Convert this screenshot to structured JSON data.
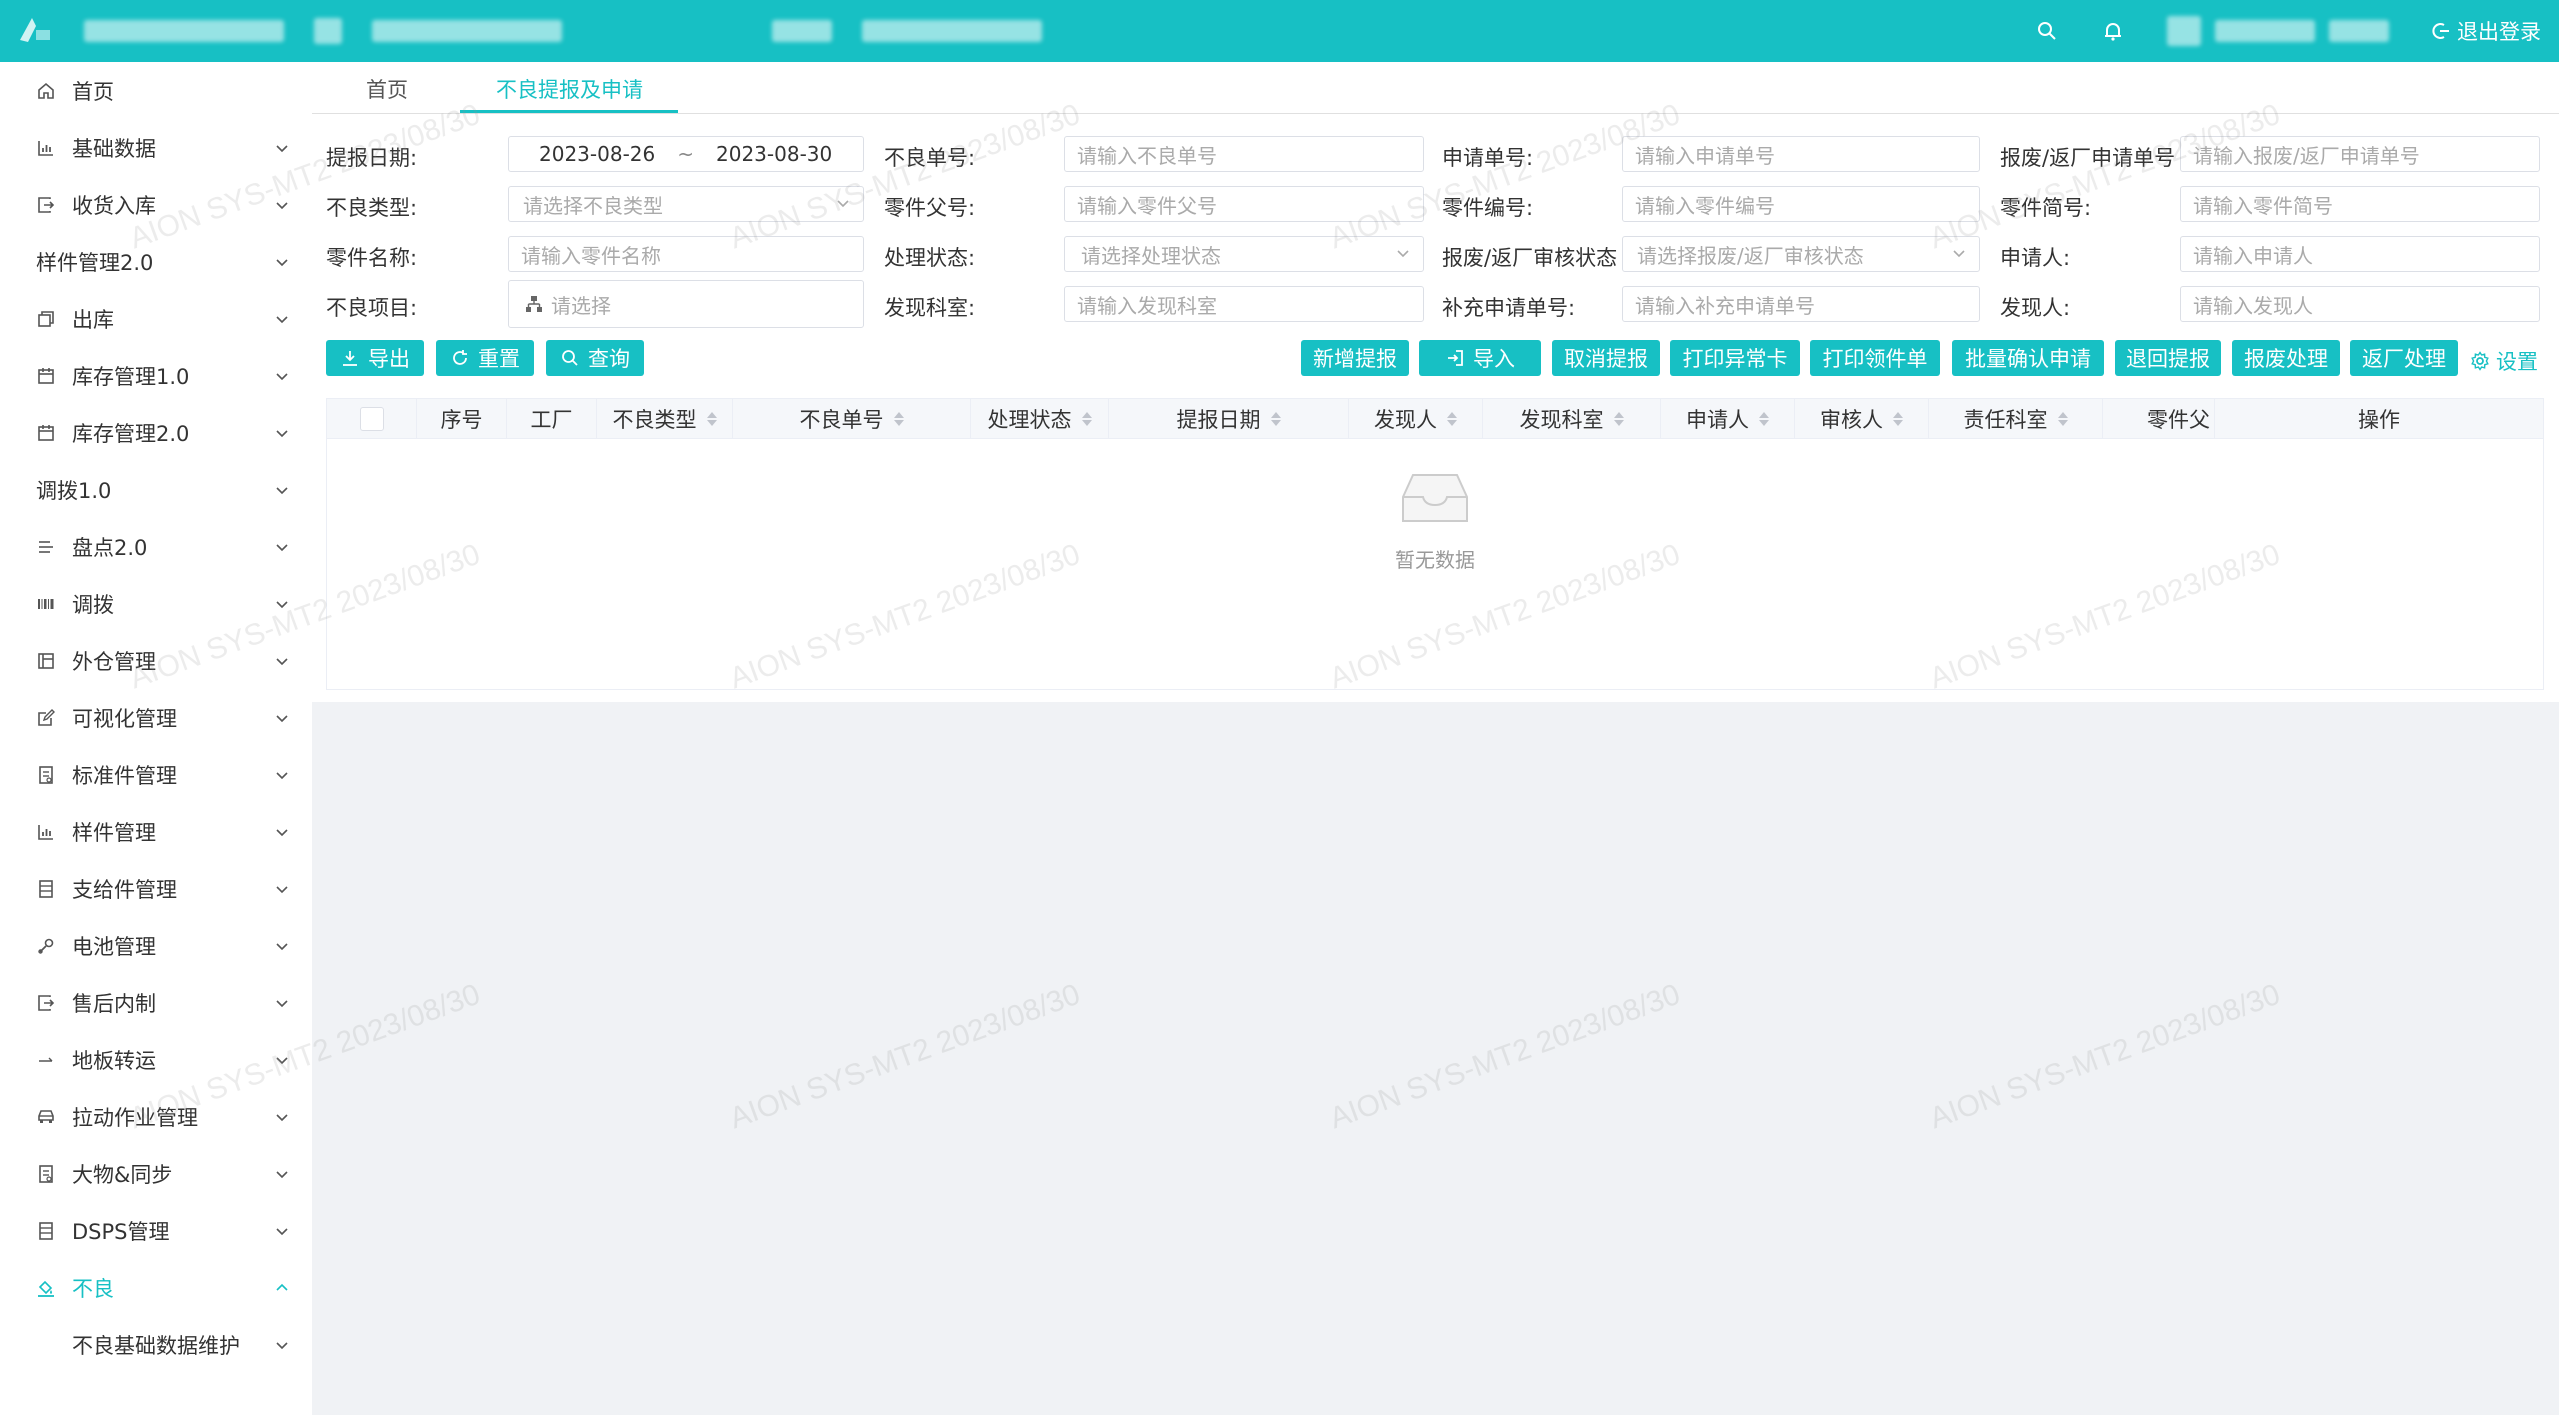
{
  "header": {
    "logout_label": "退出登录"
  },
  "sidebar": {
    "items": [
      {
        "label": "首页",
        "icon": "home-icon",
        "chevron": false
      },
      {
        "label": "基础数据",
        "icon": "bar-chart-icon",
        "chevron": true
      },
      {
        "label": "收货入库",
        "icon": "login-box-icon",
        "chevron": true
      },
      {
        "label": "样件管理2.0",
        "icon": "",
        "chevron": true
      },
      {
        "label": "出库",
        "icon": "copy-icon",
        "chevron": true
      },
      {
        "label": "库存管理1.0",
        "icon": "calendar-icon",
        "chevron": true
      },
      {
        "label": "库存管理2.0",
        "icon": "calendar-icon",
        "chevron": true
      },
      {
        "label": "调拨1.0",
        "icon": "",
        "chevron": true
      },
      {
        "label": "盘点2.0",
        "icon": "list-icon",
        "chevron": true
      },
      {
        "label": "调拨",
        "icon": "barcode-icon",
        "chevron": true
      },
      {
        "label": "外仓管理",
        "icon": "layout-icon",
        "chevron": true
      },
      {
        "label": "可视化管理",
        "icon": "edit-icon",
        "chevron": true
      },
      {
        "label": "标准件管理",
        "icon": "document-icon",
        "chevron": true
      },
      {
        "label": "样件管理",
        "icon": "bar-chart-icon",
        "chevron": true
      },
      {
        "label": "支给件管理",
        "icon": "notebook-icon",
        "chevron": true
      },
      {
        "label": "电池管理",
        "icon": "tools-icon",
        "chevron": true
      },
      {
        "label": "售后内制",
        "icon": "login-box-icon",
        "chevron": true
      },
      {
        "label": "地板转运",
        "icon": "arrow-right-icon",
        "chevron": true
      },
      {
        "label": "拉动作业管理",
        "icon": "car-icon",
        "chevron": true
      },
      {
        "label": "大物&同步",
        "icon": "document-icon",
        "chevron": true
      },
      {
        "label": "DSPS管理",
        "icon": "notebook-icon",
        "chevron": true
      },
      {
        "label": "不良",
        "icon": "paint-icon",
        "chevron": true,
        "active": true,
        "expanded": true
      },
      {
        "label": "不良基础数据维护",
        "icon": "",
        "chevron": true,
        "sub": true
      }
    ]
  },
  "tabs": [
    {
      "label": "首页"
    },
    {
      "label": "不良提报及申请",
      "active": true
    }
  ],
  "filters": {
    "report_date_label": "提报日期:",
    "date_start": "2023-08-26",
    "date_sep": "~",
    "date_end": "2023-08-30",
    "defect_no_label": "不良单号:",
    "defect_no_placeholder": "请输入不良单号",
    "apply_no_label": "申请单号:",
    "apply_no_placeholder": "请输入申请单号",
    "scrap_apply_no_label": "报废/返厂申请单号",
    "scrap_apply_no_placeholder": "请输入报废/返厂申请单号",
    "defect_type_label": "不良类型:",
    "defect_type_placeholder": "请选择不良类型",
    "parent_part_label": "零件父号:",
    "parent_part_placeholder": "请输入零件父号",
    "part_no_label": "零件编号:",
    "part_no_placeholder": "请输入零件编号",
    "part_short_label": "零件简号:",
    "part_short_placeholder": "请输入零件简号",
    "part_name_label": "零件名称:",
    "part_name_placeholder": "请输入零件名称",
    "status_label": "处理状态:",
    "status_placeholder": "请选择处理状态",
    "scrap_review_label": "报废/返厂审核状态",
    "scrap_review_placeholder": "请选择报废/返厂审核状态",
    "applicant_label": "申请人:",
    "applicant_placeholder": "请输入申请人",
    "defect_item_label": "不良项目:",
    "defect_item_placeholder": "请选择",
    "dept_label": "发现科室:",
    "dept_placeholder": "请输入发现科室",
    "supp_apply_label": "补充申请单号:",
    "supp_apply_placeholder": "请输入补充申请单号",
    "finder_label": "发现人:",
    "finder_placeholder": "请输入发现人"
  },
  "toolbar": {
    "export": "导出",
    "reset": "重置",
    "query": "查询",
    "add_report": "新增提报",
    "import": "导入",
    "cancel_report": "取消提报",
    "print_exception": "打印异常卡",
    "print_pick": "打印领件单",
    "batch_confirm": "批量确认申请",
    "return_report": "退回提报",
    "scrap_process": "报废处理",
    "return_factory": "返厂处理",
    "settings": "设置"
  },
  "table": {
    "columns": [
      "序号",
      "工厂",
      "不良类型",
      "不良单号",
      "处理状态",
      "提报日期",
      "发现人",
      "发现科室",
      "申请人",
      "审核人",
      "责任科室",
      "零件父",
      "操作"
    ],
    "empty_text": "暂无数据"
  },
  "watermark": "AION SYS-MT2 2023/08/30",
  "colors": {
    "accent": "#17c0c4"
  }
}
